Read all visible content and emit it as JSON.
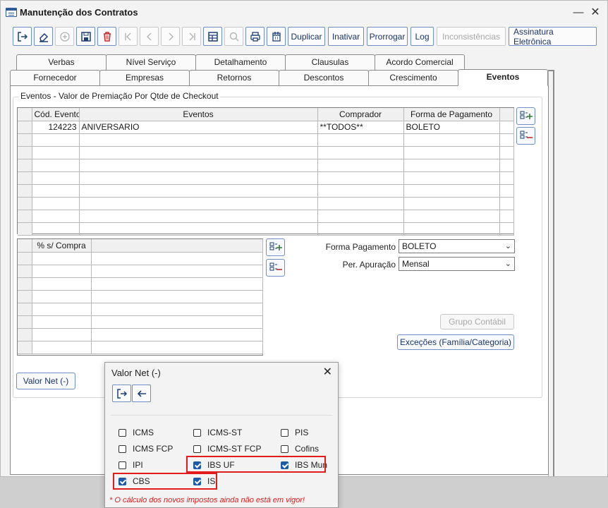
{
  "window": {
    "title": "Manutenção dos Contratos",
    "minimize": "—",
    "close": "✕"
  },
  "toolbar": {
    "icons": [
      "exit-icon",
      "eraser-icon",
      "add-icon",
      "save-icon",
      "delete-icon",
      "first-icon",
      "prev-icon",
      "next-icon",
      "last-icon",
      "grid-icon",
      "search-icon",
      "print-icon",
      "calendar-icon"
    ],
    "buttons": [
      {
        "label": "Duplicar",
        "enabled": true
      },
      {
        "label": "Inativar",
        "enabled": true
      },
      {
        "label": "Prorrogar",
        "enabled": true
      },
      {
        "label": "Log",
        "enabled": true
      },
      {
        "label": "Inconsistências",
        "enabled": false
      },
      {
        "label": "Assinatura Eletrônica",
        "enabled": true
      }
    ]
  },
  "tabs": {
    "row1": [
      "Verbas",
      "Nível Serviço",
      "Detalhamento",
      "Clausulas",
      "Acordo Comercial"
    ],
    "row2": [
      "Fornecedor",
      "Empresas",
      "Retornos",
      "Descontos",
      "Crescimento",
      "Eventos"
    ],
    "active": "Eventos"
  },
  "events": {
    "group_title": "Eventos - Valor de Premiação Por Qtde de Checkout",
    "columns": [
      "Cód. Evento",
      "Eventos",
      "Comprador",
      "Forma de Pagamento"
    ],
    "rows": [
      [
        "124223",
        "ANIVERSARIO",
        "**TODOS**",
        "BOLETO"
      ]
    ]
  },
  "purchase": {
    "columns": [
      "% s/ Compra",
      ""
    ]
  },
  "form": {
    "payment_label": "Forma Pagamento",
    "payment_value": "BOLETO",
    "period_label": "Per. Apuração",
    "period_value": "Mensal",
    "accounting_group": "Grupo Contábil",
    "exceptions": "Exceções (Família/Categoria)",
    "valor_net": "Valor Net (-)"
  },
  "dialog": {
    "title": "Valor Net (-)",
    "close": "✕",
    "checkboxes": [
      {
        "label": "ICMS",
        "checked": false
      },
      {
        "label": "ICMS-ST",
        "checked": false
      },
      {
        "label": "PIS",
        "checked": false
      },
      {
        "label": "ICMS FCP",
        "checked": false
      },
      {
        "label": "ICMS-ST FCP",
        "checked": false
      },
      {
        "label": "Cofins",
        "checked": false
      },
      {
        "label": "IPI",
        "checked": false
      },
      {
        "label": "IBS UF",
        "checked": true
      },
      {
        "label": "IBS Mun",
        "checked": true
      },
      {
        "label": "CBS",
        "checked": true
      },
      {
        "label": "IS",
        "checked": true
      }
    ],
    "note": "* O cálculo dos novos impostos ainda não está em vigor!"
  },
  "colors": {
    "accent": "#1e5aa8",
    "border": "#6f8fc6",
    "highlight": "#e21b1b"
  }
}
